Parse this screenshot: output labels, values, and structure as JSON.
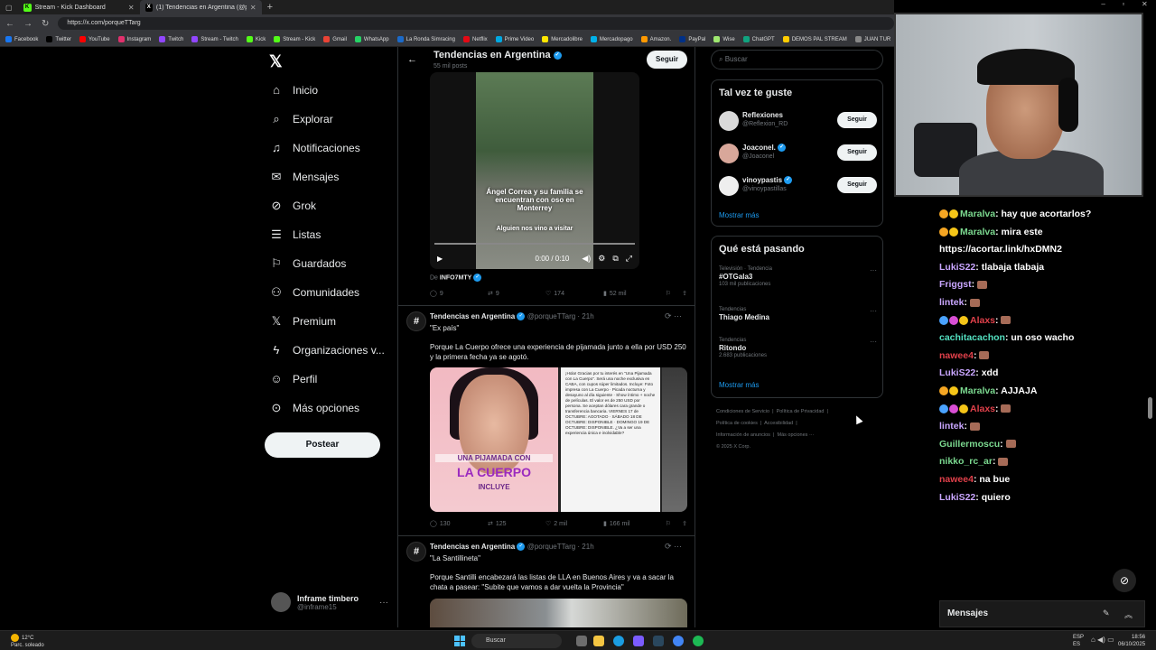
{
  "browser": {
    "tabs": [
      {
        "label": "Stream - Kick Dashboard",
        "icon": "K",
        "color": "#53fc18"
      },
      {
        "label": "(1) Tendencias en Argentina (@p...",
        "icon": "X",
        "color": "#ffffff"
      }
    ],
    "url": "https://x.com/porqueTTarg",
    "bookmarks": [
      "Facebook",
      "Twitter",
      "YouTube",
      "Instagram",
      "Twitch",
      "Stream - Twitch",
      "Kick",
      "Stream - Kick",
      "Gmail",
      "WhatsApp",
      "La Ronda Simracing",
      "Netflix",
      "Prime Video",
      "Mercadolibre",
      "Mercadopago",
      "Amazon.",
      "PayPal",
      "Wise",
      "ChatGPT",
      "DEMOS PAL STREAM",
      "JUAN TUR"
    ]
  },
  "nav": {
    "items": [
      "Inicio",
      "Explorar",
      "Notificaciones",
      "Mensajes",
      "Grok",
      "Listas",
      "Guardados",
      "Comunidades",
      "Premium",
      "Organizaciones v...",
      "Perfil",
      "Más opciones"
    ],
    "post_label": "Postear",
    "account_name": "Inframe timbero",
    "account_handle": "@inframe15"
  },
  "feed": {
    "title": "Tendencias en Argentina",
    "posts_count": "55 mil posts",
    "follow_label": "Seguir",
    "video": {
      "caption1": "Ángel Correa y su familia se encuentran con oso en Monterrey",
      "caption2": "Alguien nos vino a visitar",
      "time": "0:00 / 0:10",
      "from_prefix": "De",
      "from": "INFO7MTY"
    },
    "actions1": {
      "replies": "9",
      "reposts": "9",
      "likes": "174",
      "views": "52 mil"
    },
    "tweet2": {
      "name": "Tendencias en Argentina",
      "handle": "@porqueTTarg · 21h",
      "quote": "\"Ex país\"",
      "text": "Porque La Cuerpo ofrece una experiencia de pijamada junto a ella por USD 250 y la primera fecha ya se agotó.",
      "img_title1": "UNA PIJAMADA CON",
      "img_title2": "LA CUERPO",
      "img_title3": "INCLUYE",
      "img_text": "¡Hola! Gracias por tu interés en \"Una Pijamada con La Cuerpo\". Será una noche exclusiva en CABA, con cupos súper limitados. Incluye: Foto impresa con La Cuerpo · Picada nocturna y desayuno al día siguiente · Show íntimo + noche de películas. El valor es de 250 USD por persona. Se aceptan dólares cara grande o transferencia bancaria. VIERNES 17 de OCTUBRE: AGOTADO · SÁBADO 18 DE OCTUBRE: DISPONIBLE · DOMINGO 19 DE OCTUBRE: DISPONIBLE. ¿Va a ser una experiencia única e inolvidable?",
      "replies": "130",
      "reposts": "125",
      "likes": "2 mil",
      "views": "166 mil"
    },
    "tweet3": {
      "name": "Tendencias en Argentina",
      "handle": "@porqueTTarg · 21h",
      "quote": "\"La Santillineta\"",
      "text": "Porque Santilli encabezará las listas de LLA en Buenos Aires y va a sacar la chata a pasear: \"Subite que vamos a dar vuelta la Provincia\""
    }
  },
  "sidebar": {
    "search_placeholder": "Buscar",
    "suggest_title": "Tal vez te guste",
    "suggestions": [
      {
        "name": "Reflexiones",
        "handle": "@Reflexion_RD",
        "verified": false
      },
      {
        "name": "Joaconel.",
        "handle": "@Joaconel",
        "verified": true
      },
      {
        "name": "vinoypastis",
        "handle": "@vinoypastillas",
        "verified": true
      }
    ],
    "follow_label": "Seguir",
    "show_more": "Mostrar más",
    "trends_title": "Qué está pasando",
    "trends": [
      {
        "context": "Televisión · Tendencia",
        "topic": "#OTGala3",
        "count": "103 mil publicaciones"
      },
      {
        "context": "Tendencias",
        "topic": "Thiago Medina",
        "count": ""
      },
      {
        "context": "Tendencias",
        "topic": "Ritondo",
        "count": "2.683 publicaciones"
      }
    ],
    "footer": [
      "Condiciones de Servicio",
      "Política de Privacidad",
      "Política de cookies",
      "Accesibilidad",
      "Información de anuncios",
      "Más opciones ···",
      "© 2025 X Corp."
    ]
  },
  "chat": {
    "messages": [
      {
        "user": "Maralva",
        "color": "#7bd88f",
        "badges": [
          "#f5a623",
          "#f5c518"
        ],
        "text": ": hay que acortarlos?",
        "emote": false
      },
      {
        "user": "Maralva",
        "color": "#7bd88f",
        "badges": [
          "#f5a623",
          "#f5c518"
        ],
        "text": ": mira este",
        "emote": false
      },
      {
        "user": "",
        "color": "#ffffff",
        "badges": [],
        "text": "https://acortar.link/hxDMN2",
        "emote": false
      },
      {
        "user": "LukiS22",
        "color": "#c9a6ff",
        "badges": [],
        "text": ": tlabaja tlabaja",
        "emote": false
      },
      {
        "user": "Friggst",
        "color": "#c9a6ff",
        "badges": [],
        "text": ":",
        "emote": true
      },
      {
        "user": "lintek",
        "color": "#c9a6ff",
        "badges": [],
        "text": ":",
        "emote": true
      },
      {
        "user": "Alaxs",
        "color": "#e0404a",
        "badges": [
          "#4aa3ff",
          "#d94fd4",
          "#f5c518"
        ],
        "text": ":",
        "emote": true
      },
      {
        "user": "cachitacachon",
        "color": "#53e0c0",
        "badges": [],
        "text": ": un oso wacho",
        "emote": false
      },
      {
        "user": "nawee4",
        "color": "#e0404a",
        "badges": [],
        "text": ":",
        "emote": true
      },
      {
        "user": "LukiS22",
        "color": "#c9a6ff",
        "badges": [],
        "text": ": xdd",
        "emote": false
      },
      {
        "user": "Maralva",
        "color": "#7bd88f",
        "badges": [
          "#f5a623",
          "#f5c518"
        ],
        "text": ": AJJAJA",
        "emote": false
      },
      {
        "user": "Alaxs",
        "color": "#e0404a",
        "badges": [
          "#4aa3ff",
          "#d94fd4",
          "#f5c518"
        ],
        "text": ":",
        "emote": true
      },
      {
        "user": "lintek",
        "color": "#c9a6ff",
        "badges": [],
        "text": ":",
        "emote": true
      },
      {
        "user": "Guillermoscu",
        "color": "#7bd88f",
        "badges": [],
        "text": ":",
        "emote": true
      },
      {
        "user": "nikko_rc_ar",
        "color": "#7bd88f",
        "badges": [],
        "text": ":",
        "emote": true
      },
      {
        "user": "nawee4",
        "color": "#e0404a",
        "badges": [],
        "text": ": na bue",
        "emote": false
      },
      {
        "user": "LukiS22",
        "color": "#c9a6ff",
        "badges": [],
        "text": ": quiero",
        "emote": false
      }
    ],
    "panel_label": "Mensajes"
  },
  "taskbar": {
    "temp": "12°C",
    "weather": "Parc. soleado",
    "search": "Buscar",
    "lang1": "ESP",
    "lang2": "ES",
    "time": "18:56",
    "date": "06/10/2025"
  }
}
